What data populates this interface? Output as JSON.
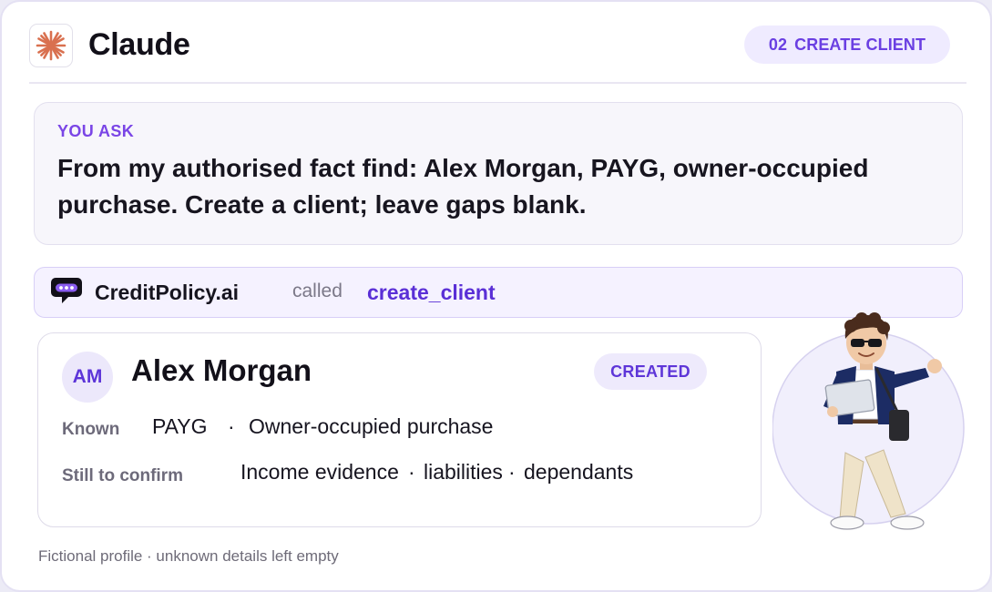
{
  "header": {
    "app_title": "Claude",
    "logo_icon": "claude-starburst-icon",
    "step_number": "02",
    "step_label": "CREATE CLIENT"
  },
  "prompt": {
    "label": "YOU ASK",
    "text": "From my authorised fact find: Alex Morgan, PAYG, owner-occupied purchase. Create a client; leave gaps blank."
  },
  "tool_call": {
    "service_name": "CreditPolicy.ai",
    "service_icon": "creditpolicy-chat-icon",
    "verb": "called",
    "function_name": "create_client"
  },
  "client": {
    "initials": "AM",
    "name": "Alex Morgan",
    "status": "CREATED",
    "known_label": "Known",
    "known": [
      "PAYG",
      "Owner-occupied purchase"
    ],
    "pending_label": "Still to confirm",
    "pending": [
      "Income evidence",
      "liabilities",
      "dependants"
    ],
    "separator": "·"
  },
  "footnote": "Fictional profile · unknown details left empty",
  "colors": {
    "accent": "#6a3fe2",
    "accent_dark": "#5a2fd6",
    "accent_soft": "#efebff",
    "logo_orange": "#d9704f"
  }
}
